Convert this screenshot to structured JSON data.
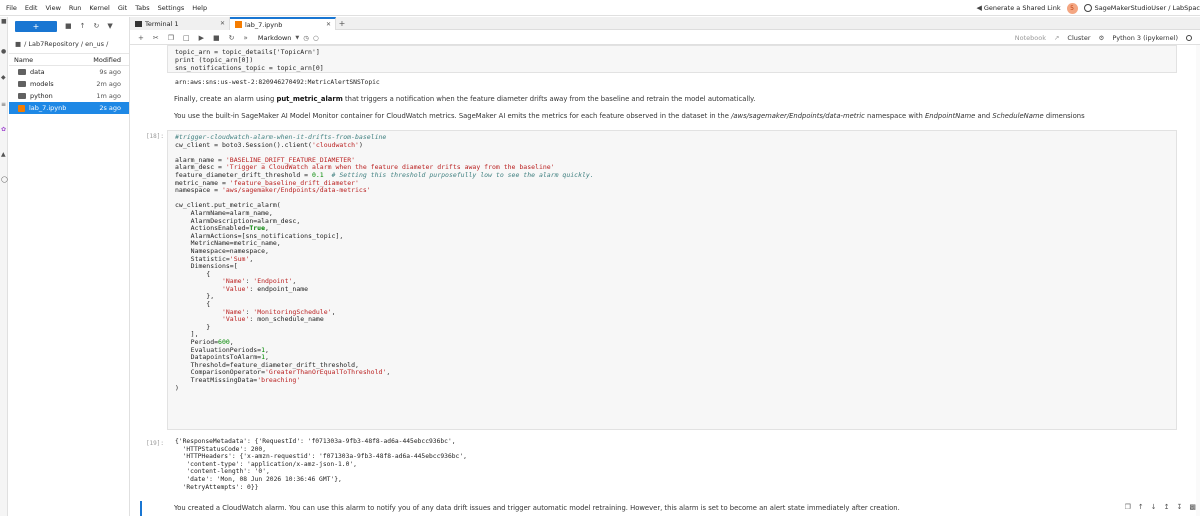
{
  "menubar": {
    "items": [
      "File",
      "Edit",
      "View",
      "Run",
      "Kernel",
      "Git",
      "Tabs",
      "Settings",
      "Help"
    ],
    "share_label": "Generate a Shared Link",
    "badge_count": "5",
    "user_label": "SageMakerStudioUser / LabSpac"
  },
  "filebrowser": {
    "new_label": "+",
    "path": "/ Lab7Repository / en_us /",
    "col_name": "Name",
    "col_modified": "Modified",
    "files": [
      {
        "name": "data",
        "modified": "9s ago",
        "type": "folder"
      },
      {
        "name": "models",
        "modified": "2m ago",
        "type": "folder"
      },
      {
        "name": "python",
        "modified": "1m ago",
        "type": "folder"
      },
      {
        "name": "lab_7.ipynb",
        "modified": "2s ago",
        "type": "notebook",
        "selected": true
      }
    ]
  },
  "tabs": [
    {
      "label": "Terminal 1"
    },
    {
      "label": "lab_7.ipynb"
    }
  ],
  "toolbar": {
    "cell_type": "Markdown",
    "notebook_label": "Notebook",
    "cluster_label": "Cluster",
    "kernel_label": "Python 3 (ipykernel)"
  },
  "cells": {
    "top_code": [
      "topic_arn = topic_details['TopicArn']",
      "print (topic_arn[0])",
      "sns_notifications_topic = topic_arn[0]"
    ],
    "top_output": "arn:aws:sns:us-west-2:820946270492:MetricAlertSNSTopic",
    "md1_prefix": "Finally, create an alarm using ",
    "md1_bold": "put_metric_alarm",
    "md1_suffix": " that triggers a notification when the feature diameter drifts away from the baseline and retrain the model automatically.",
    "md2_a": "You use the built-in SageMaker AI Model Monitor container for CloudWatch metrics. SageMaker AI emits the metrics for each feature observed in the dataset in the ",
    "md2_ns": "/aws/sagemaker/Endpoints/data-metric",
    "md2_b": " namespace with ",
    "md2_ep": "EndpointName",
    "md2_c": " and ",
    "md2_sn": "ScheduleName",
    "md2_d": " dimensions",
    "prompt_18": "[18]:",
    "prompt_19": "[19]:",
    "output_19": [
      "{'ResponseMetadata': {'RequestId': 'f071303a-9fb3-48f8-ad6a-445ebcc936bc',",
      "  'HTTPStatusCode': 200,",
      "  'HTTPHeaders': {'x-amzn-requestid': 'f071303a-9fb3-48f8-ad6a-445ebcc936bc',",
      "   'content-type': 'application/x-amz-json-1.0',",
      "   'content-length': '0',",
      "   'date': 'Mon, 08 Jun 2026 10:36:46 GMT'},",
      "  'RetryAttempts': 0}}"
    ],
    "md3": "You created a CloudWatch alarm. You can use this alarm to notify you of any data drift issues and trigger automatic model retraining. However, this alarm is set to become an alert state immediately after creation."
  }
}
